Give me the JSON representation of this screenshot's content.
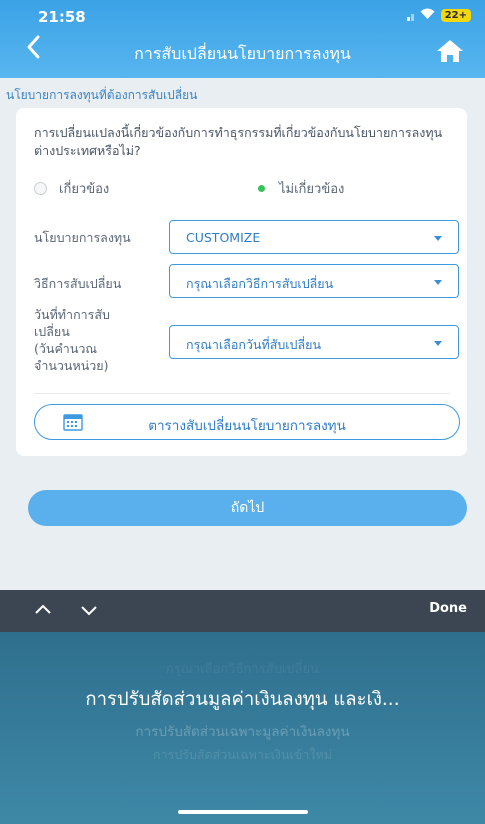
{
  "status": {
    "time": "21:58",
    "battery": "22+"
  },
  "header": {
    "back": "‹",
    "title": "การสับเปลี่ยนนโยบายการลงทุน"
  },
  "section_title": "นโยบายการลงทุนที่ต้องการสับเปลี่ยน",
  "form": {
    "question": "การเปลี่ยนแปลงนี้เกี่ยวข้องกับการทำธุรกรรมที่เกี่ยวข้องกับนโยบายการลงทุนต่างประเทศหรือไม่?",
    "radio_related": "เกี่ยวข้อง",
    "radio_unrelated": "ไม่เกี่ยวข้อง",
    "selected_radio": "unrelated",
    "policy_label": "นโยบายการลงทุน",
    "policy_value": "CUSTOMIZE",
    "method_label": "วิธีการสับเปลี่ยน",
    "method_value": "กรุณาเลือกวิธีการสับเปลี่ยน",
    "date_label_1": "วันที่ทำการสับ",
    "date_label_2": "เปลี่ยน",
    "date_label_3": "(วันคำนวณ",
    "date_label_4": "จำนวนหน่วย)",
    "date_value": "กรุณาเลือกวันที่สับเปลี่ยน",
    "schedule_button": "ตารางสับเปลี่ยนนโยบายการลงทุน"
  },
  "next_button": "ถัดไป",
  "toolbar": {
    "done": "Done"
  },
  "picker": {
    "option_above": "กรุณาเลือกวิธีการสับเปลี่ยน",
    "selected": "การปรับสัดส่วนมูลค่าเงินลงทุน และเงิ...",
    "option_2": "การปรับสัดส่วนเฉพาะมูลค่าเงินลงทุน",
    "option_3": "การปรับสัดส่วนเฉพาะเงินเข้าใหม่"
  },
  "colors": {
    "header": "#3aa2e6",
    "accent": "#3d9ae0",
    "radio_on": "#35c25a",
    "picker_bg": "#2f6f8e"
  }
}
